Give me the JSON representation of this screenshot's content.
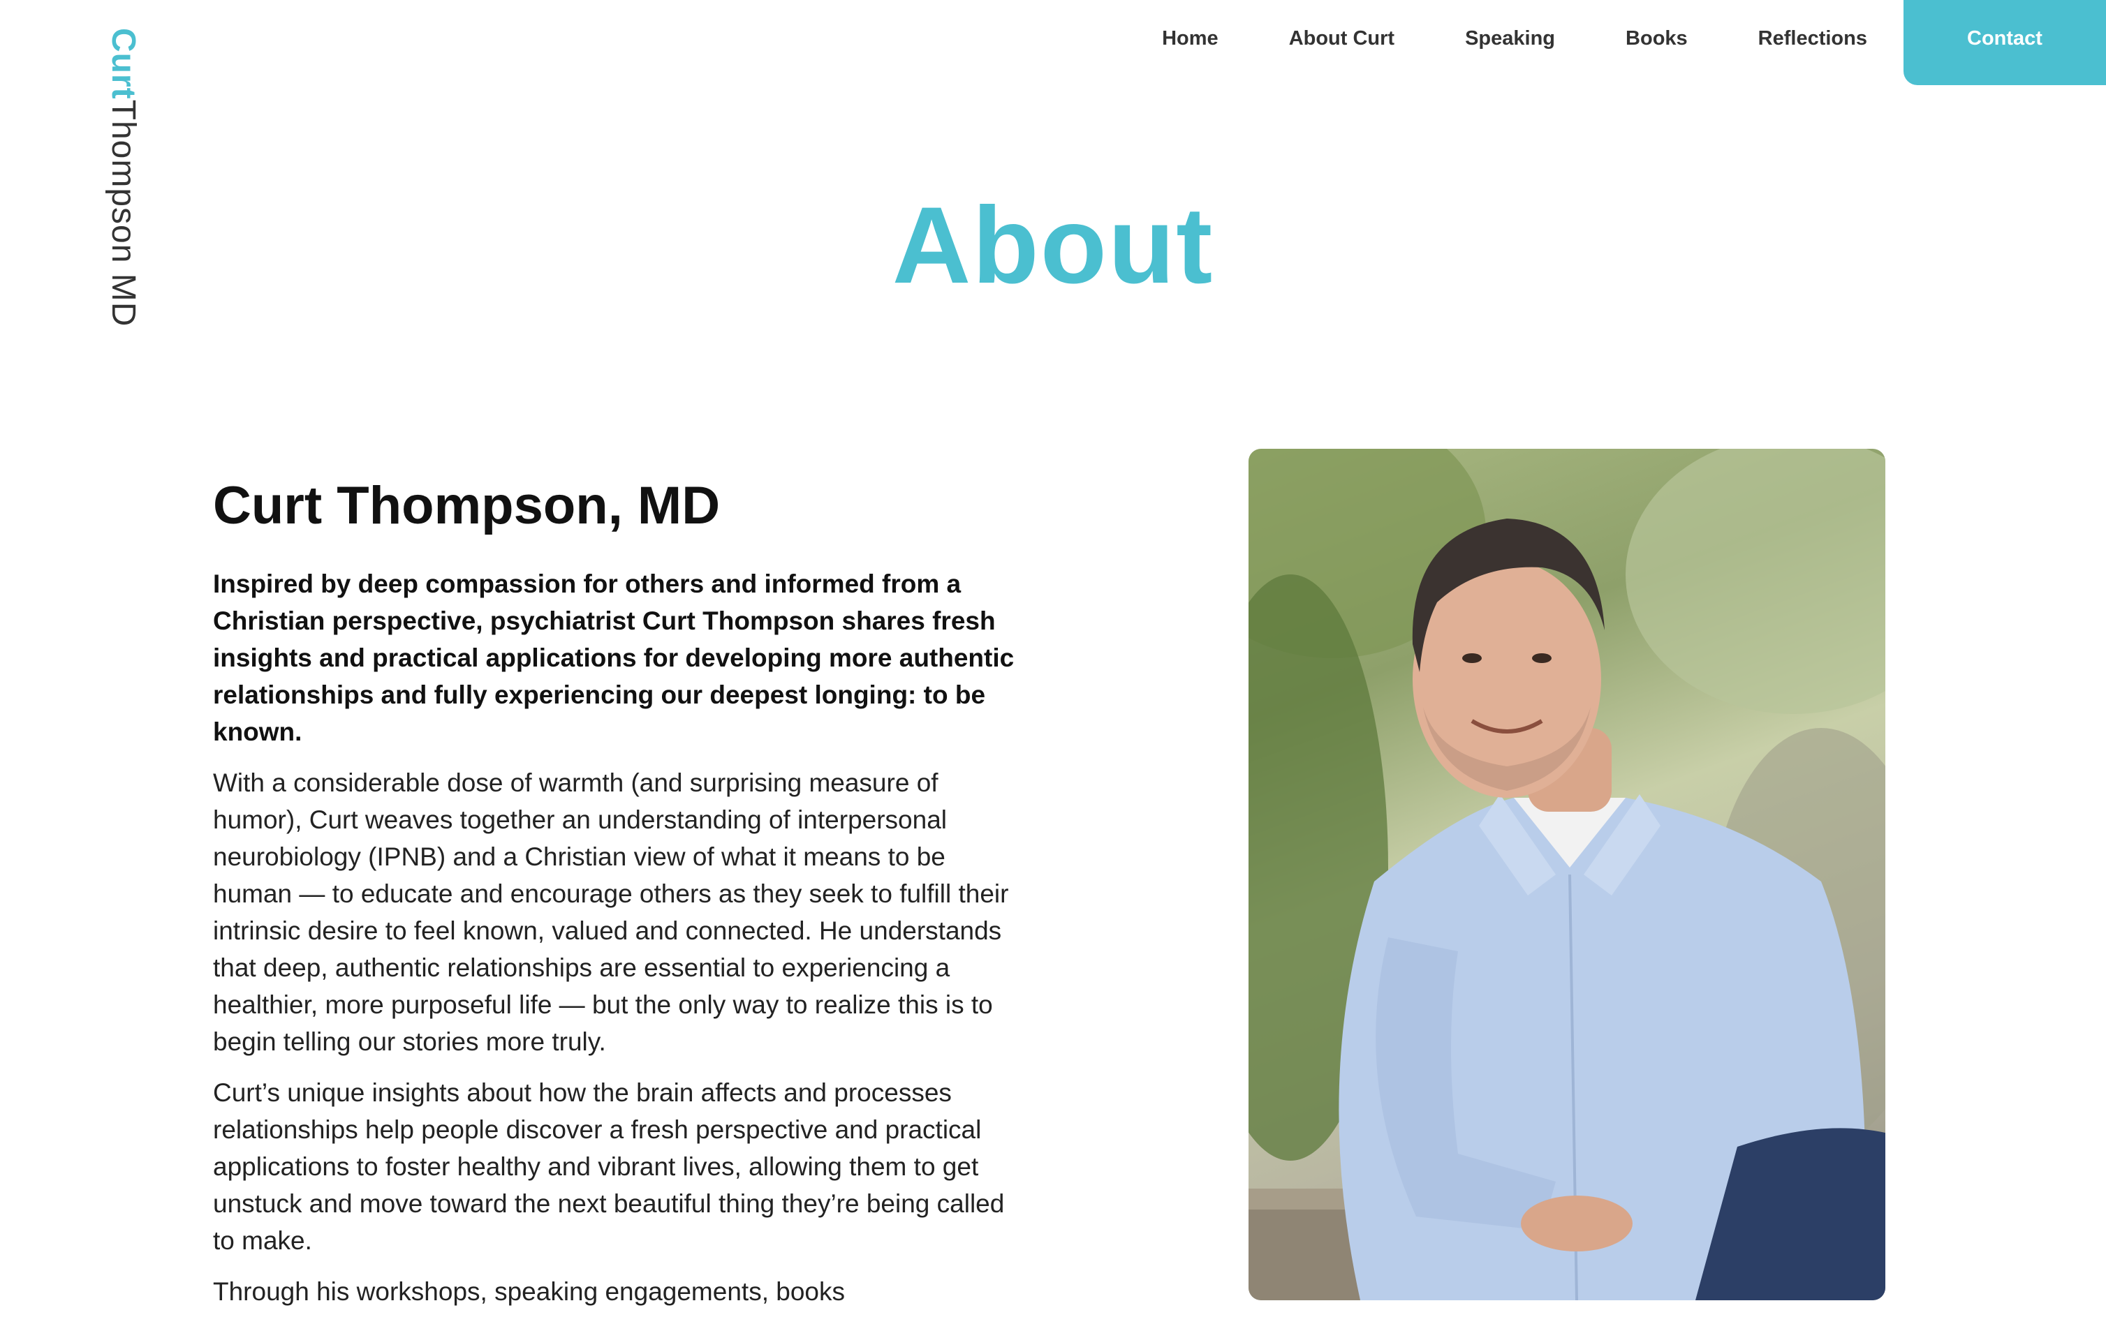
{
  "brand": {
    "first": "Curt",
    "last": "Thompson MD"
  },
  "nav": {
    "items": [
      {
        "label": "Home"
      },
      {
        "label": "About Curt"
      },
      {
        "label": "Speaking"
      },
      {
        "label": "Books"
      },
      {
        "label": "Reflections"
      }
    ],
    "contact_label": "Contact"
  },
  "page": {
    "title": "About"
  },
  "about": {
    "heading": "Curt Thompson, MD",
    "lead": "Inspired by deep compassion for others and informed from a Christian perspective, psychiatrist Curt Thompson shares fresh insights and practical applications for developing more authentic relationships and fully experiencing our deepest longing: to be known.",
    "paragraphs": [
      "With a considerable dose of warmth (and surprising measure of humor), Curt weaves together an understanding of interpersonal neurobiology (IPNB) and a Christian view of what it means to be human — to educate and encourage others as they seek to fulfill their intrinsic desire to feel known, valued and connected. He understands that deep, authentic relationships are essential to experiencing a healthier, more purposeful life — but the only way to realize this is to begin telling our stories more truly.",
      "Curt’s unique insights about how the brain affects and processes relationships help people discover a fresh perspective and practical applications to foster healthy and vibrant lives, allowing them to get unstuck and move toward the next beautiful thing they’re being called to make.",
      "Through his workshops, speaking engagements, books"
    ]
  },
  "colors": {
    "accent": "#4bbfd0",
    "text": "#111111"
  }
}
